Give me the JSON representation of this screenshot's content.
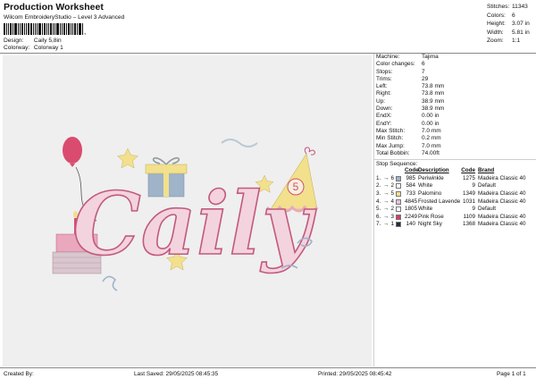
{
  "header": {
    "title": "Production Worksheet",
    "subtitle": "Wilcom EmbroideryStudio – Level 3 Advanced",
    "design_label": "Design:",
    "design_value": "Caily 5,8in",
    "colorway_label": "Colorway:",
    "colorway_value": "Colorway 1",
    "barcode_trailing": ","
  },
  "summary": [
    {
      "label": "Stitches:",
      "value": "11343"
    },
    {
      "label": "Colors:",
      "value": "6"
    },
    {
      "label": "Height:",
      "value": "3.07 in"
    },
    {
      "label": "Width:",
      "value": "5.81 in"
    },
    {
      "label": "Zoom:",
      "value": "1:1"
    }
  ],
  "machine_info": [
    {
      "label": "Machine:",
      "value": "Tajima"
    },
    {
      "label": "Color changes:",
      "value": "6"
    },
    {
      "label": "Stops:",
      "value": "7"
    },
    {
      "label": "Trims:",
      "value": "29"
    },
    {
      "label": "Left:",
      "value": "73.8 mm"
    },
    {
      "label": "Right:",
      "value": "73.8 mm"
    },
    {
      "label": "Up:",
      "value": "38.9 mm"
    },
    {
      "label": "Down:",
      "value": "38.9 mm"
    },
    {
      "label": "EndX:",
      "value": "0.00 in"
    },
    {
      "label": "EndY:",
      "value": "0.00 in"
    },
    {
      "label": "Max Stitch:",
      "value": "7.0 mm"
    },
    {
      "label": "Min Stitch:",
      "value": "0.2 mm"
    },
    {
      "label": "Max Jump:",
      "value": "7.0 mm"
    },
    {
      "label": "Total Bobbin:",
      "value": "74.00ft"
    }
  ],
  "stop_sequence": {
    "title": "Stop Sequence:",
    "headers": {
      "code": "Code",
      "description": "Description",
      "code2": "Code",
      "brand": "Brand"
    },
    "rows": [
      {
        "num": "1.",
        "id": "6",
        "color": "#9fb3c9",
        "code": "985",
        "description": "Periwinkle",
        "stitches": "1275",
        "brand": "Madeira Classic 40"
      },
      {
        "num": "2.",
        "id": "2",
        "color": "#ffffff",
        "code": "584",
        "description": "White",
        "stitches": "9",
        "brand": "Default"
      },
      {
        "num": "3.",
        "id": "5",
        "color": "#f2e08c",
        "code": "733",
        "description": "Palomino",
        "stitches": "1349",
        "brand": "Madeira Classic 40"
      },
      {
        "num": "4.",
        "id": "4",
        "color": "#e6c3d7",
        "code": "4845",
        "description": "Frosted Lavender",
        "stitches": "1031",
        "brand": "Madeira Classic 40"
      },
      {
        "num": "5.",
        "id": "2",
        "color": "#ffffff",
        "code": "1805",
        "description": "White",
        "stitches": "9",
        "brand": "Default"
      },
      {
        "num": "6.",
        "id": "3",
        "color": "#d63b6a",
        "code": "2249",
        "description": "Pink Rose",
        "stitches": "1109",
        "brand": "Madeira Classic 40"
      },
      {
        "num": "7.",
        "id": "1",
        "color": "#222a3a",
        "code": "140",
        "description": "Night Sky",
        "stitches": "1368",
        "brand": "Madeira Classic 40"
      }
    ]
  },
  "design_preview": {
    "lettering": "Caily",
    "hat_number": "5",
    "colors": {
      "pink": "#e9a8bd",
      "pink_dark": "#c25a7c",
      "yellow": "#f2e08c",
      "blue": "#9fb3c9",
      "red": "#d94c6f"
    }
  },
  "footer": {
    "created_by": "Created By:",
    "last_saved": "Last Saved: 29/05/2025 08:45:35",
    "printed": "Printed: 29/05/2025 08:45:42",
    "page": "Page 1 of 1"
  }
}
